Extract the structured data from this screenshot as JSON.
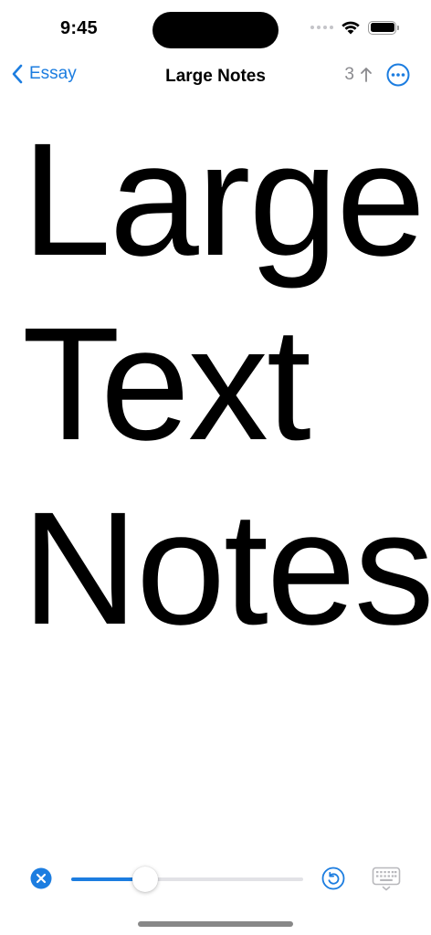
{
  "status_bar": {
    "time": "9:45"
  },
  "nav": {
    "back_label": "Essay",
    "title": "Large Notes",
    "page_count": "3"
  },
  "content": {
    "lines": [
      "Large",
      "Text",
      "Notes"
    ]
  },
  "toolbar": {
    "text_size_level": 0.32
  },
  "icons": {
    "back": "chevron-left-icon",
    "share": "arrow-up-icon",
    "more": "ellipsis-circle-icon",
    "clear": "xmark-circle-icon",
    "reset": "arrow-counterclockwise-circle-icon",
    "keyboard": "keyboard-dismiss-icon"
  },
  "colors": {
    "accent": "#1c7de0",
    "secondary_text": "#8a8a8e",
    "track": "#e2e2e6"
  }
}
